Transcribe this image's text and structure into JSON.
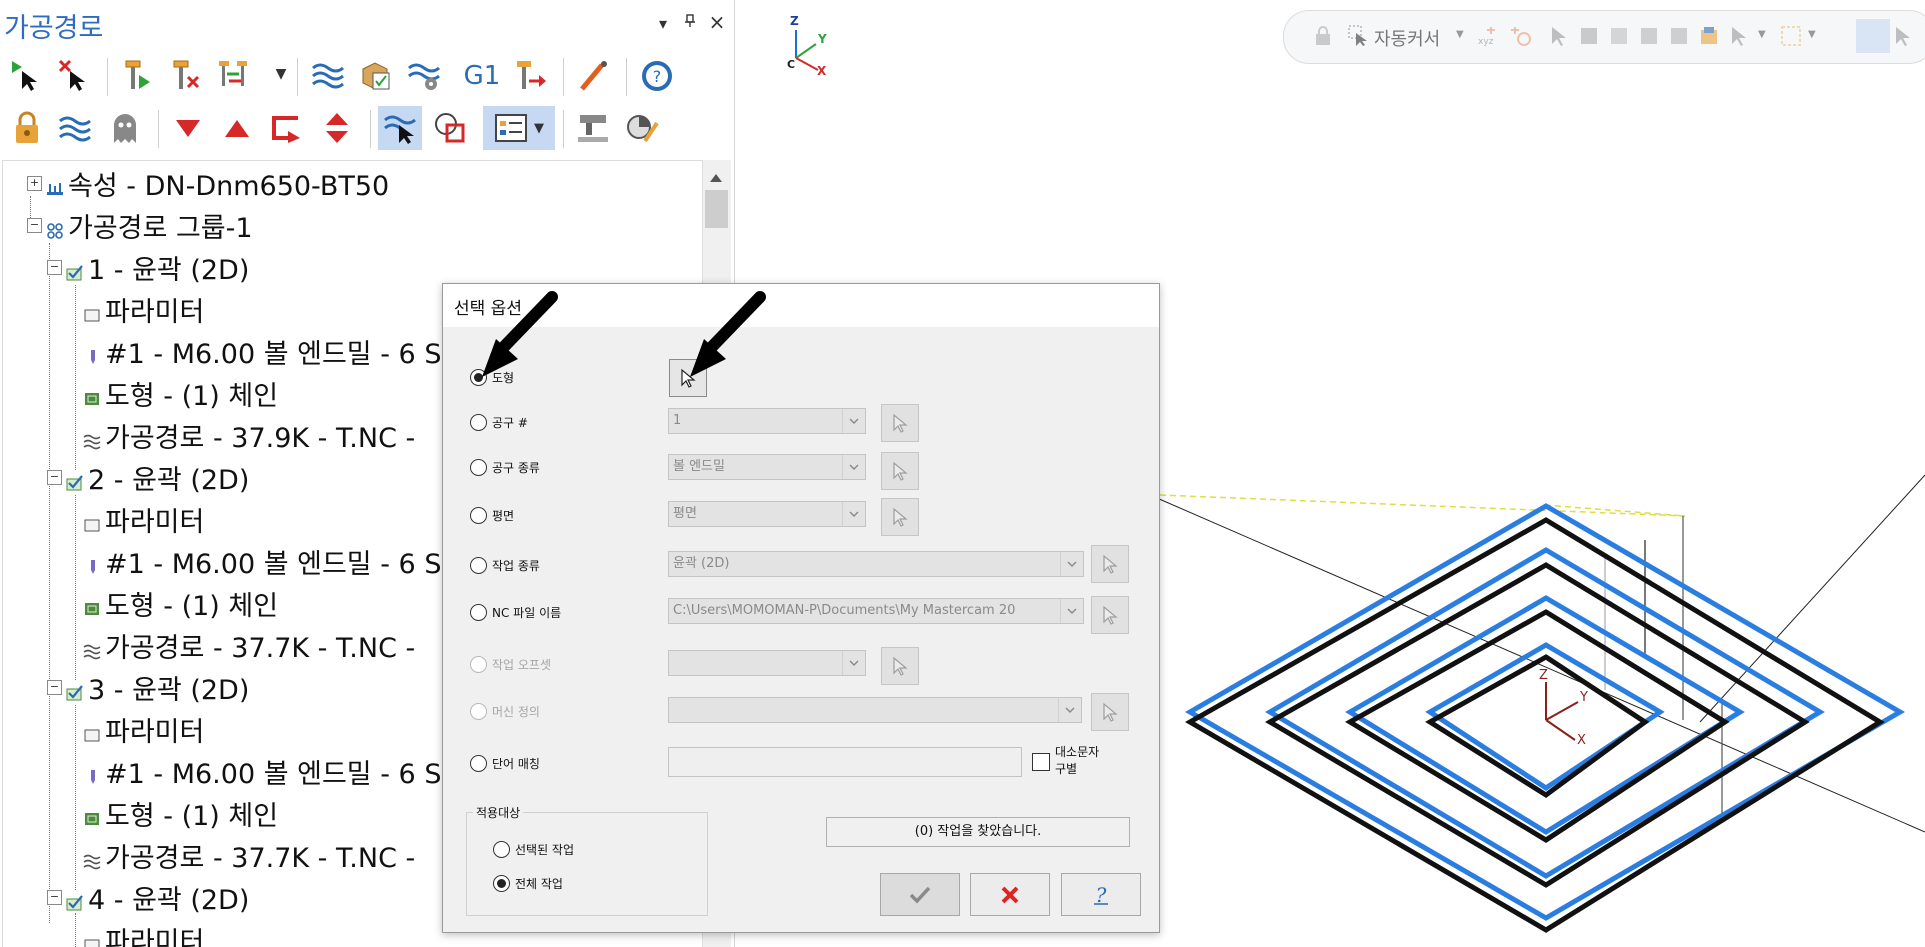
{
  "panel": {
    "title": "가공경로",
    "controls": {
      "dropdown": "▾",
      "pin": "ᵖ",
      "close": "×"
    }
  },
  "tree": {
    "machine": "속성 - DN-Dnm650-BT50",
    "group": "가공경로 그룹-1",
    "operations": [
      {
        "title": "1 - 윤곽 (2D)",
        "param": "파라미터",
        "tool": "#1 - M6.00 볼 엔드밀 - 6 S",
        "geom": "도형 - (1) 체인",
        "path": "가공경로 - 37.9K - T.NC -"
      },
      {
        "title": "2 - 윤곽 (2D)",
        "param": "파라미터",
        "tool": "#1 - M6.00 볼 엔드밀 - 6 S",
        "geom": "도형 - (1) 체인",
        "path": "가공경로 - 37.7K - T.NC -"
      },
      {
        "title": "3 - 윤곽 (2D)",
        "param": "파라미터",
        "tool": "#1 - M6.00 볼 엔드밀 - 6 S",
        "geom": "도형 - (1) 체인",
        "path": "가공경로 - 37.7K - T.NC -"
      },
      {
        "title": "4 - 윤곽 (2D)",
        "param": "파라미터"
      }
    ]
  },
  "toolbar1_g1": "G1",
  "viewport": {
    "autocursor_label": "자동커서",
    "gnomon_top": {
      "z": "Z",
      "y": "Y",
      "c": "C",
      "x": "X"
    },
    "gnomon_center": {
      "z": "Z",
      "y": "Y",
      "x": "X"
    }
  },
  "colors": {
    "accent": "#2f6bc1",
    "path_blue": "#2a7de1",
    "path_black": "#111111"
  },
  "dialog": {
    "title": "선택 옵션",
    "options": {
      "geometry": "도형",
      "tool_num": "공구 #",
      "tool_type": "공구 종류",
      "plane": "평면",
      "op_type": "작업 종류",
      "nc_file": "NC 파일 이름",
      "work_offset": "작업 오프셋",
      "machine_def": "머신 정의",
      "word_match": "단어 매칭"
    },
    "values": {
      "tool_num": "1",
      "tool_type": "볼 엔드밀",
      "plane": "평면",
      "op_type": "윤곽 (2D)",
      "nc_file": "C:\\Users\\MOMOMAN-P\\Documents\\My Mastercam 20",
      "work_offset": "",
      "machine_def": "",
      "word_match": ""
    },
    "case_sensitive": "대소문자\n구별",
    "apply_group": "적용대상",
    "apply_selected": "선택된 작업",
    "apply_all": "전체 작업",
    "status": "(0) 작업을 찾았습니다."
  }
}
